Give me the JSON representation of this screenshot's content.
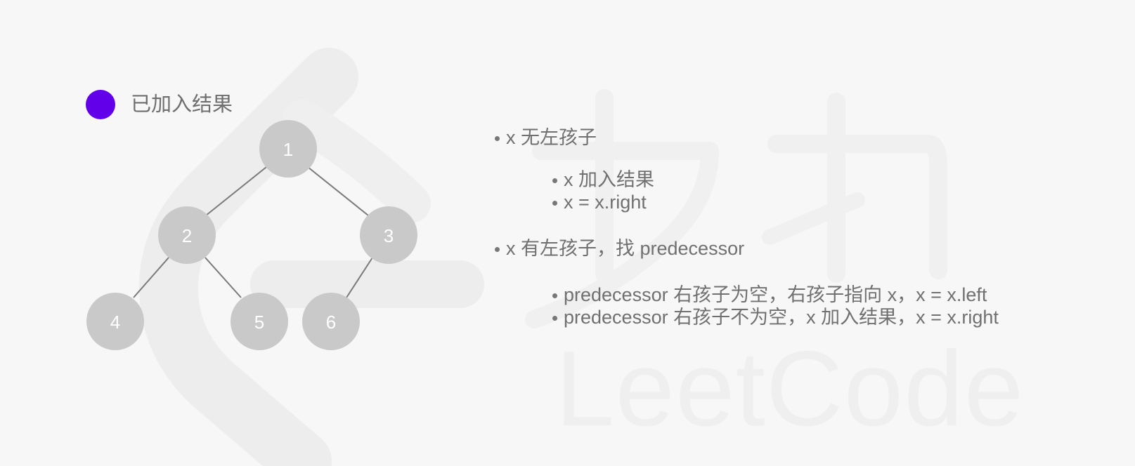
{
  "legend": {
    "label": "已加入结果",
    "color": "#6200ea"
  },
  "tree": {
    "nodes": [
      {
        "id": "1",
        "label": "1"
      },
      {
        "id": "2",
        "label": "2"
      },
      {
        "id": "3",
        "label": "3"
      },
      {
        "id": "4",
        "label": "4"
      },
      {
        "id": "5",
        "label": "5"
      },
      {
        "id": "6",
        "label": "6"
      }
    ],
    "edges": [
      [
        "1",
        "2"
      ],
      [
        "1",
        "3"
      ],
      [
        "2",
        "4"
      ],
      [
        "2",
        "5"
      ],
      [
        "3",
        "6"
      ]
    ]
  },
  "notes": {
    "case1": "x 无左孩子",
    "case1_step1": "x 加入结果",
    "case1_step2": "x = x.right",
    "case2": "x 有左孩子，找 predecessor",
    "case2_step1": "predecessor 右孩子为空，右孩子指向 x，x = x.left",
    "case2_step2": "predecessor 右孩子不为空，x 加入结果，x = x.right"
  },
  "watermark": {
    "text": "LeetCode"
  }
}
